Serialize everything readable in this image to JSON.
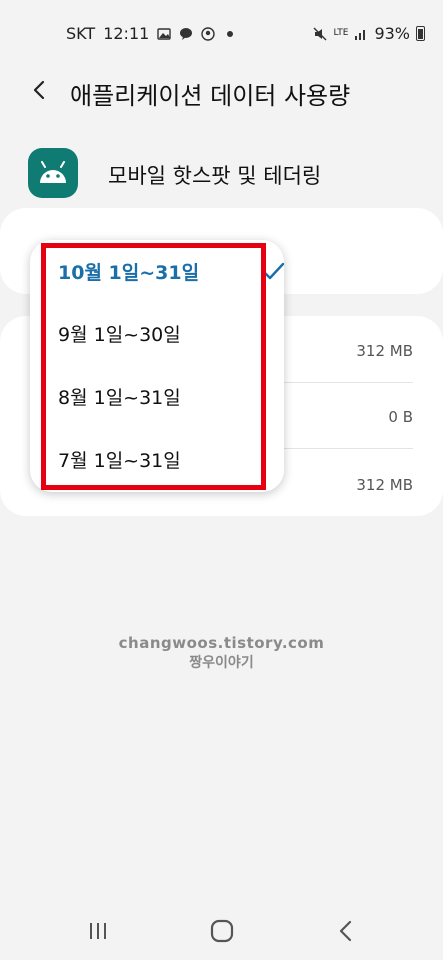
{
  "status_bar": {
    "carrier": "SKT",
    "time": "12:11",
    "network": "LTE",
    "battery": "93%"
  },
  "header": {
    "title": "애플리케이션 데이터 사용량"
  },
  "app": {
    "name": "모바일 핫스팟 및 테더링",
    "icon_color": "#0f7b72"
  },
  "usage_rows": [
    {
      "label": "",
      "value": "312 MB"
    },
    {
      "label": "",
      "value": "0 B"
    },
    {
      "label": "",
      "value": "312 MB"
    }
  ],
  "dropdown": {
    "options": [
      {
        "label": "10월 1일~31일",
        "selected": true
      },
      {
        "label": "9월 1일~30일",
        "selected": false
      },
      {
        "label": "8월 1일~31일",
        "selected": false
      },
      {
        "label": "7월 1일~31일",
        "selected": false
      }
    ],
    "accent_color": "#1a6fa8",
    "highlight_color": "#e50012"
  },
  "watermark": {
    "line1": "changwoos.tistory.com",
    "line2": "짱우이야기"
  }
}
